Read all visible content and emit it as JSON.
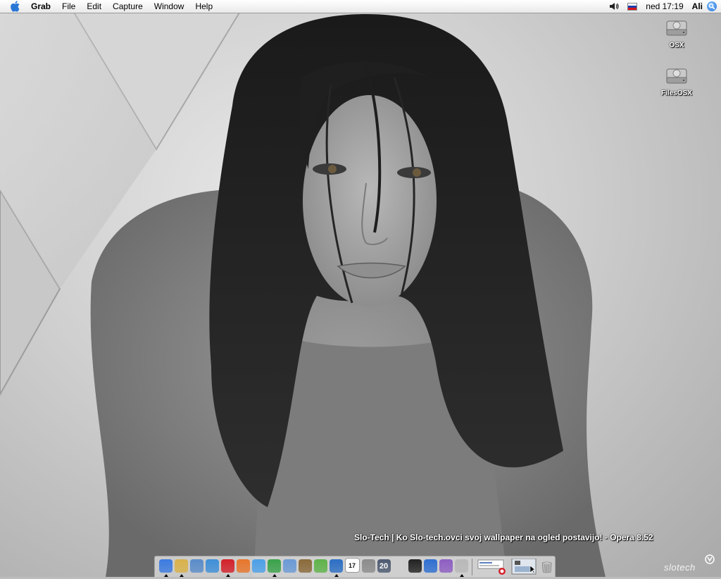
{
  "menubar": {
    "apple_icon": "apple-icon",
    "app_name": "Grab",
    "menus": [
      "File",
      "Edit",
      "Capture",
      "Window",
      "Help"
    ],
    "volume_icon": "speaker-icon",
    "flag_icon": "slovenia-flag-icon",
    "clock": "ned 17:19",
    "user": "Ali",
    "spotlight_icon": "spotlight-icon"
  },
  "desktop_icons": [
    {
      "label": "OSX",
      "icon": "hard-disk-icon"
    },
    {
      "label": "FilesOSX",
      "icon": "hard-disk-icon"
    }
  ],
  "window_title": "Slo-Tech | Ko Slo-tech.ovci svoj wallpaper na ogled postavijo! - Opera 8.52",
  "dock": {
    "apps": [
      {
        "name": "finder-icon",
        "color": "#3b7be0",
        "running": true
      },
      {
        "name": "grab-icon",
        "color": "#d9b24a",
        "running": true
      },
      {
        "name": "preview-icon",
        "color": "#5a8cc9",
        "running": false
      },
      {
        "name": "safari-icon",
        "color": "#3f8fd8",
        "running": false
      },
      {
        "name": "opera-icon",
        "color": "#d3202a",
        "running": true
      },
      {
        "name": "firefox-icon",
        "color": "#e8762b",
        "running": false
      },
      {
        "name": "ichat-icon",
        "color": "#4da0e8",
        "running": false
      },
      {
        "name": "msn-icon",
        "color": "#3aa24a",
        "running": true
      },
      {
        "name": "mail-icon",
        "color": "#6b9ad6",
        "running": false
      },
      {
        "name": "iphoto-icon",
        "color": "#8a6a3a",
        "running": false
      },
      {
        "name": "itunes-icon",
        "color": "#5fb34a",
        "running": false
      },
      {
        "name": "quicktime-icon",
        "color": "#2c6ec4",
        "running": true
      },
      {
        "name": "ical-icon",
        "color": "#e04040",
        "running": false
      },
      {
        "name": "system-prefs-icon",
        "color": "#8c8c8c",
        "running": false
      },
      {
        "name": "dashboard-icon",
        "color": "#4d5a70",
        "running": false
      },
      {
        "name": "textedit-icon",
        "color": "#cfcfcf",
        "running": false
      },
      {
        "name": "terminal-icon",
        "color": "#222222",
        "running": false
      },
      {
        "name": "word-icon",
        "color": "#2f6fd1",
        "running": false
      },
      {
        "name": "entourage-icon",
        "color": "#8e5ec2",
        "running": false
      },
      {
        "name": "grab-screenshot-icon",
        "color": "#b9b9b9",
        "running": true
      }
    ],
    "ical_day": "17",
    "dashboard_label": "20",
    "minimized_icon": "minimized-window-icon",
    "trash_icon": "trash-icon"
  },
  "watermark": "slotech"
}
